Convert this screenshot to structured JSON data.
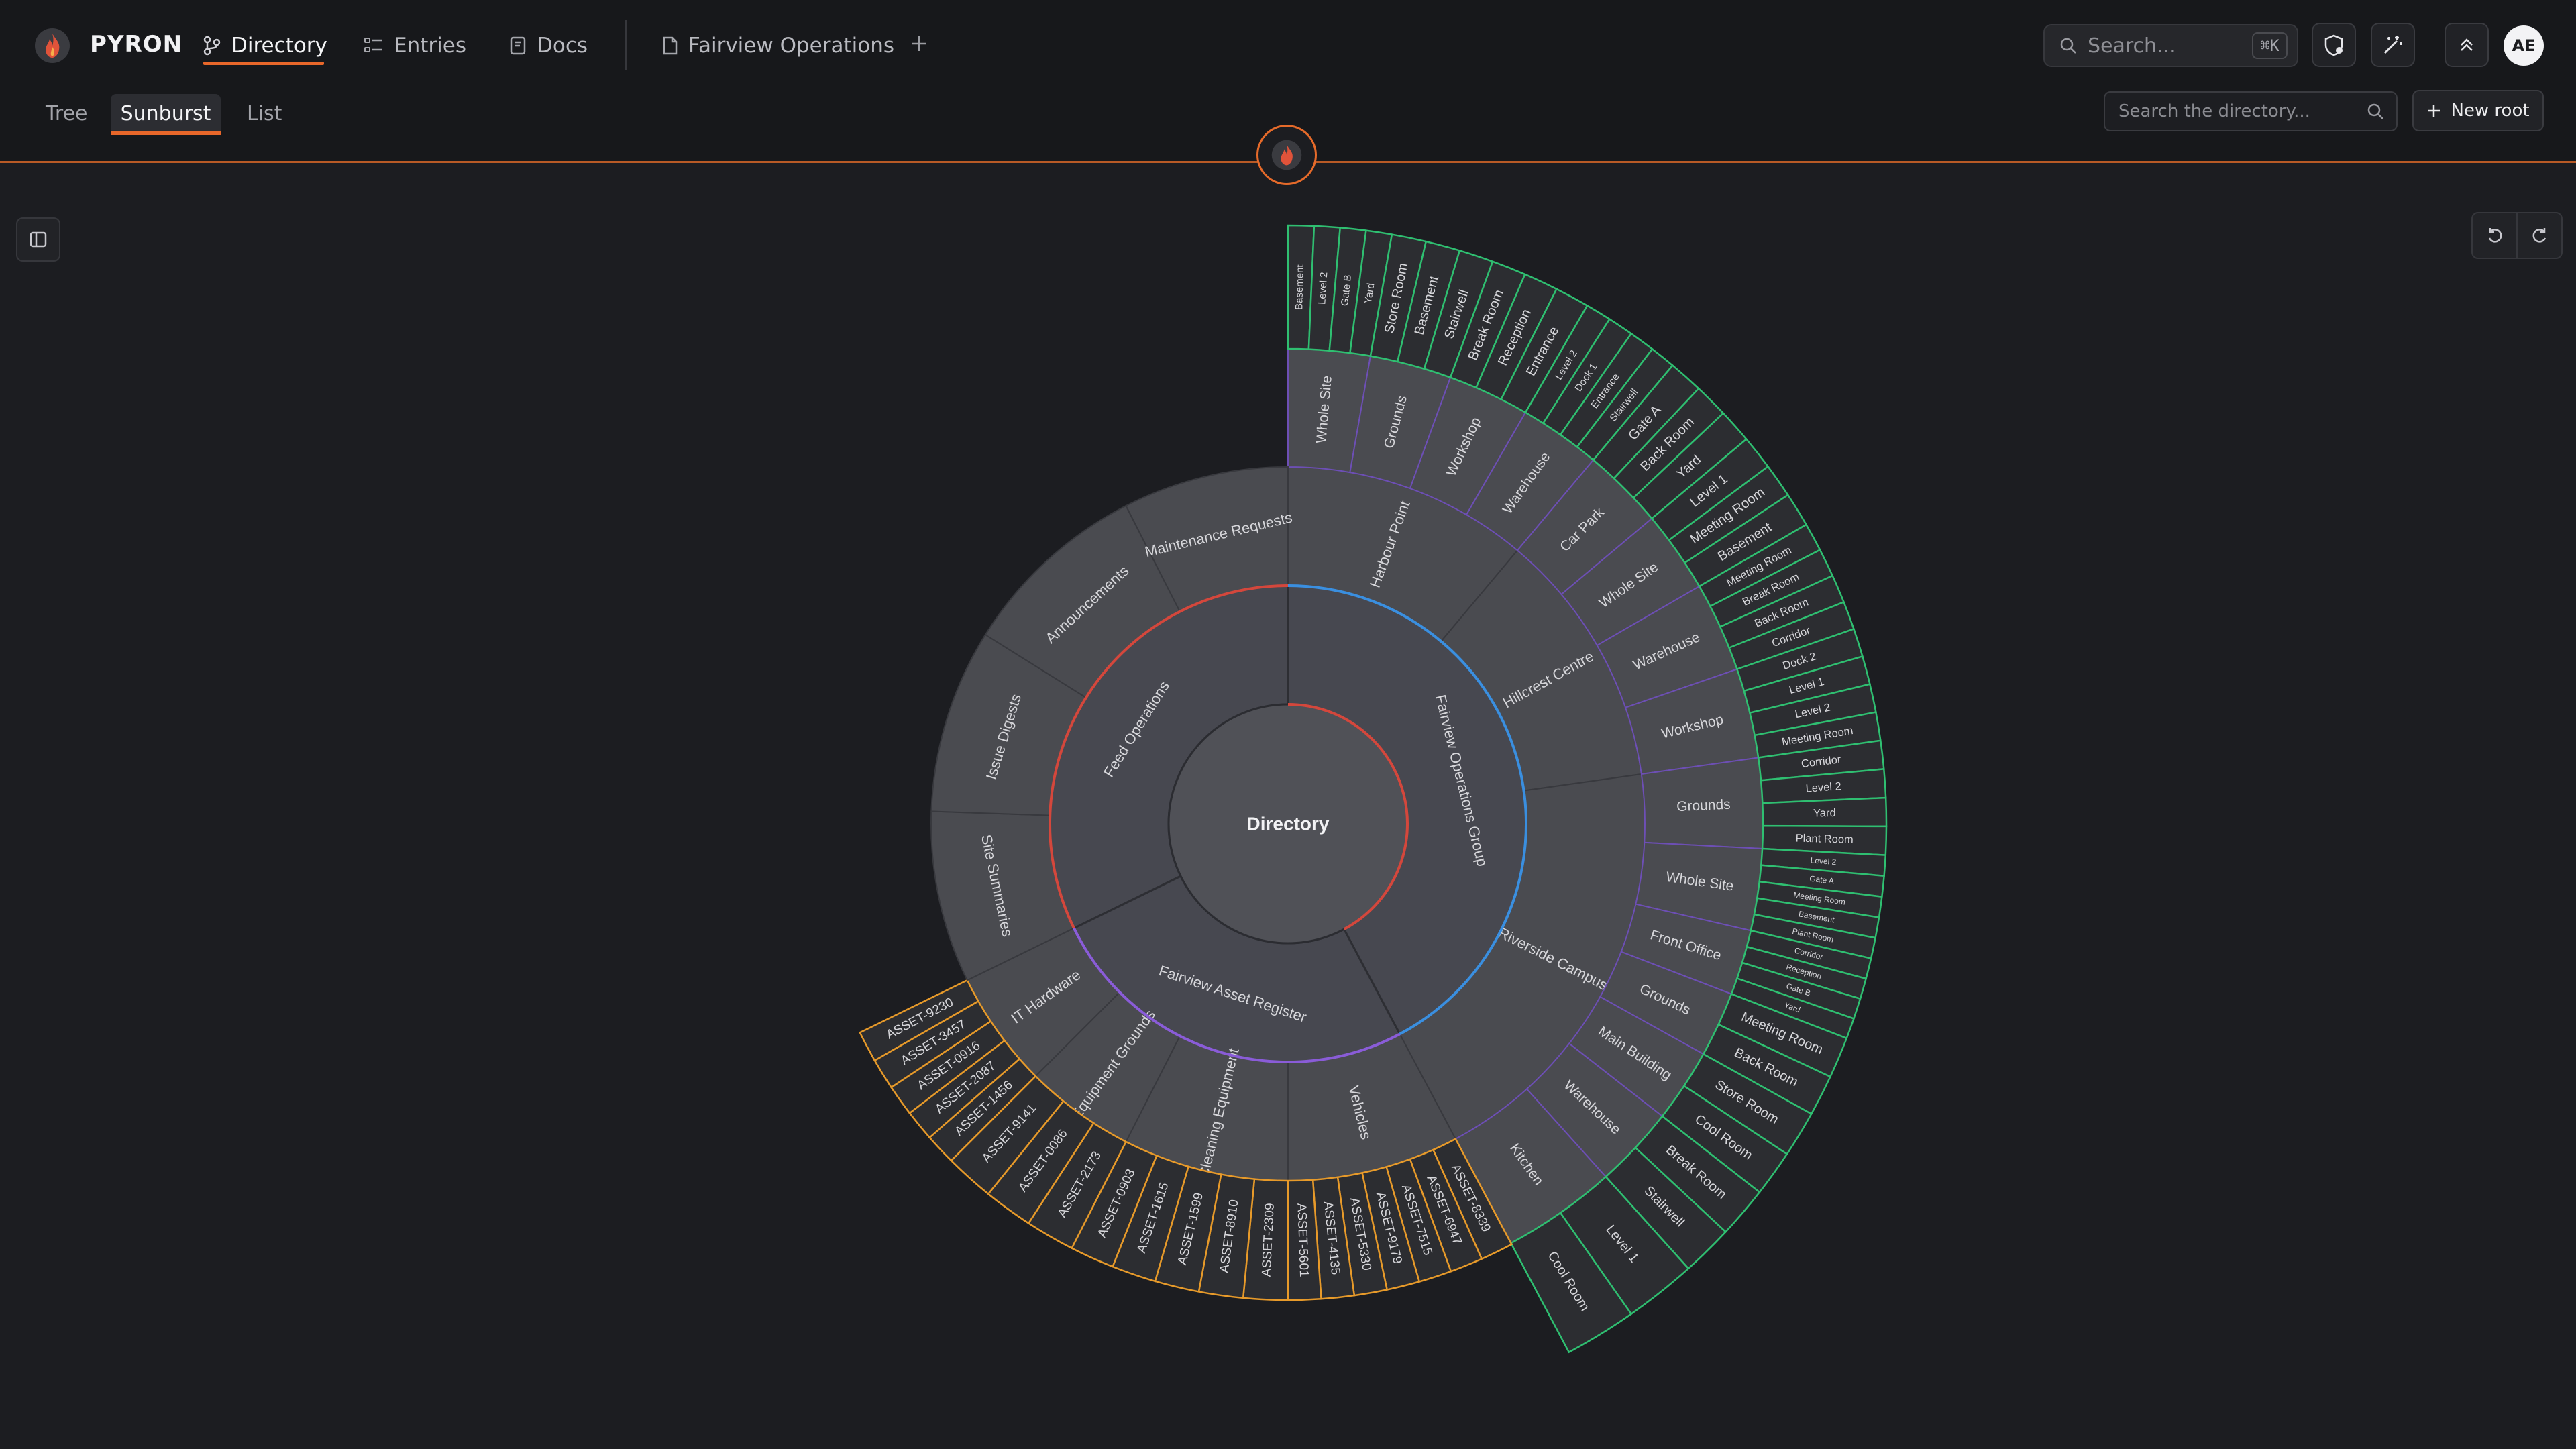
{
  "app": {
    "name": "PYRON"
  },
  "nav": [
    {
      "label": "Directory",
      "icon": "branch-icon",
      "active": true
    },
    {
      "label": "Entries",
      "icon": "list-icon",
      "active": false
    },
    {
      "label": "Docs",
      "icon": "book-icon",
      "active": false
    },
    {
      "label": "Fairview Operations",
      "icon": "page-icon",
      "active": false
    }
  ],
  "search": {
    "placeholder": "Search...",
    "shortcut": "⌘K"
  },
  "user": {
    "initials": "AE"
  },
  "views": [
    {
      "label": "Tree",
      "active": false
    },
    {
      "label": "Sunburst",
      "active": true
    },
    {
      "label": "List",
      "active": false
    }
  ],
  "directory_search": {
    "placeholder": "Search the directory..."
  },
  "new_root": {
    "label": "New root"
  },
  "colors": {
    "accent": "#e8672a",
    "ring_blue": "#3a8fe0",
    "ring_red": "#d4473c",
    "ring_purple": "#8a5cd8",
    "ring_green": "#2fbf71",
    "ring_orange": "#e79a2a",
    "segment_fill": "#4a4b50"
  },
  "sunburst": {
    "root": "Directory",
    "groups": [
      {
        "name": "Fairview Operations Group",
        "start": 0,
        "end": 152,
        "color": "ring_blue",
        "children": [
          {
            "name": "Harbour Point",
            "start": 0,
            "end": 40,
            "children": [
              {
                "name": "Whole Site",
                "start": 0,
                "end": 10,
                "leaves": [
                  "Basement",
                  "Level 2",
                  "Gate B",
                  "Yard"
                ]
              },
              {
                "name": "Grounds",
                "start": 10,
                "end": 20,
                "leaves": [
                  "Store Room",
                  "Basement",
                  "Stairwell"
                ]
              },
              {
                "name": "Workshop",
                "start": 20,
                "end": 30,
                "leaves": [
                  "Break Room",
                  "Reception",
                  "Entrance"
                ]
              },
              {
                "name": "Warehouse",
                "start": 30,
                "end": 40,
                "leaves": [
                  "Level 2",
                  "Dock 1",
                  "Entrance",
                  "Stairwell"
                ]
              }
            ]
          },
          {
            "name": "Hillcrest Centre",
            "start": 40,
            "end": 82,
            "children": [
              {
                "name": "Car Park",
                "start": 40,
                "end": 50,
                "leaves": [
                  "Gate A",
                  "Back Room",
                  "Yard"
                ]
              },
              {
                "name": "Whole Site",
                "start": 50,
                "end": 60,
                "leaves": [
                  "Level 1",
                  "Meeting Room",
                  "Basement"
                ]
              },
              {
                "name": "Warehouse",
                "start": 60,
                "end": 71,
                "leaves": [
                  "Meeting Room",
                  "Break Room",
                  "Back Room",
                  "Corridor"
                ]
              },
              {
                "name": "Workshop",
                "start": 71,
                "end": 82,
                "leaves": [
                  "Dock 2",
                  "Level 1",
                  "Level 2",
                  "Meeting Room"
                ]
              }
            ]
          },
          {
            "name": "Riverside Campus",
            "start": 82,
            "end": 152,
            "children": [
              {
                "name": "Grounds",
                "start": 82,
                "end": 93,
                "leaves": [
                  "Corridor",
                  "Level 2",
                  "Yard",
                  "Plant Room"
                ]
              },
              {
                "name": "Whole Site",
                "start": 93,
                "end": 103,
                "leaves": [
                  "Level 2",
                  "Gate A",
                  "Meeting Room",
                  "Basement",
                  "Plant Room"
                ]
              },
              {
                "name": "Front Office",
                "start": 103,
                "end": 111,
                "leaves": [
                  "Corridor",
                  "Reception",
                  "Gate B",
                  "Yard"
                ]
              },
              {
                "name": "Grounds",
                "start": 111,
                "end": 119,
                "leaves": [
                  "Meeting Room",
                  "Back Room"
                ]
              },
              {
                "name": "Main Building",
                "start": 119,
                "end": 128,
                "leaves": [
                  "Store Room",
                  "Cool Room"
                ]
              },
              {
                "name": "Warehouse",
                "start": 128,
                "end": 138,
                "leaves": [
                  "Break Room",
                  "Stairwell"
                ]
              },
              {
                "name": "Kitchen",
                "start": 138,
                "end": 152,
                "leaves": [
                  "Level 1",
                  "Cool Room"
                ]
              }
            ]
          }
        ]
      },
      {
        "name": "Fairview Asset Register",
        "start": 152,
        "end": 244,
        "color": "ring_purple",
        "children": [
          {
            "name": "Vehicles",
            "start": 152,
            "end": 180,
            "leaves": [
              "ASSET-8339",
              "ASSET-6947",
              "ASSET-7515",
              "ASSET-9179",
              "ASSET-5330",
              "ASSET-4135",
              "ASSET-5601"
            ]
          },
          {
            "name": "Cleaning Equipment",
            "start": 180,
            "end": 207,
            "leaves": [
              "ASSET-2309",
              "ASSET-8910",
              "ASSET-1599",
              "ASSET-1615",
              "ASSET-0903"
            ]
          },
          {
            "name": "Equipment Grounds",
            "start": 207,
            "end": 225,
            "leaves": [
              "ASSET-2173",
              "ASSET-0086",
              "ASSET-9141"
            ]
          },
          {
            "name": "IT Hardware",
            "start": 225,
            "end": 244,
            "leaves": [
              "ASSET-1456",
              "ASSET-2087",
              "ASSET-0916",
              "ASSET-3457",
              "ASSET-9230"
            ]
          }
        ]
      },
      {
        "name": "Feed Operations",
        "start": 244,
        "end": 360,
        "color": "ring_red",
        "children": [
          {
            "name": "Site Summaries",
            "start": 244,
            "end": 272,
            "leaves": []
          },
          {
            "name": "Issue Digests",
            "start": 272,
            "end": 302,
            "leaves": []
          },
          {
            "name": "Announcements",
            "start": 302,
            "end": 333,
            "leaves": []
          },
          {
            "name": "Maintenance Requests",
            "start": 333,
            "end": 360,
            "leaves": []
          }
        ]
      }
    ]
  }
}
